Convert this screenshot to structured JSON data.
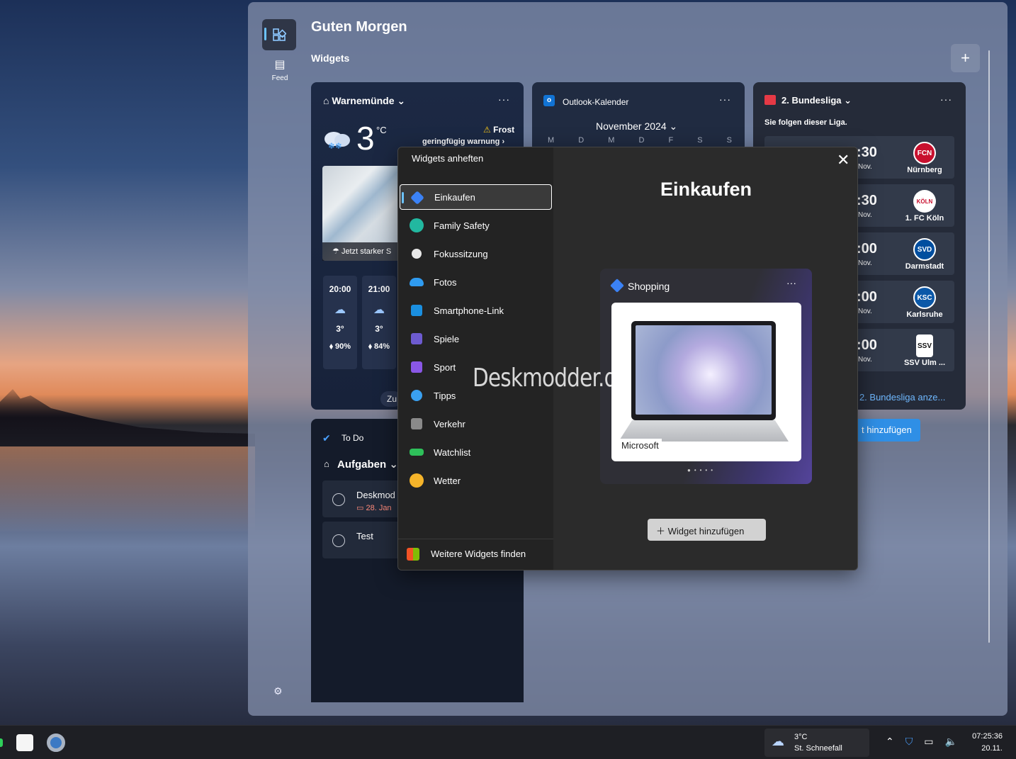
{
  "board": {
    "greeting": "Guten Morgen",
    "widgets_label": "Widgets",
    "feed_label": "Feed",
    "add_symbol": "+"
  },
  "weather": {
    "location": "Warnemünde",
    "temperature": "3",
    "unit": "°C",
    "alert_title": "Frost",
    "alert_text": "geringfügig warnung",
    "map_note": "Jetzt starker S",
    "hours": [
      {
        "time": "20:00",
        "temp": "3°",
        "precip": "90%"
      },
      {
        "time": "21:00",
        "temp": "3°",
        "precip": "84%"
      }
    ],
    "more_label": "Zu"
  },
  "calendar": {
    "title": "Outlook-Kalender",
    "month": "November 2024",
    "weekdays": [
      "M",
      "D",
      "M",
      "D",
      "F",
      "S",
      "S"
    ]
  },
  "liga": {
    "title": "2. Bundesliga",
    "subtitle": "Sie folgen dieser Liga.",
    "matches": [
      {
        "time": ":30",
        "day": "Nov.",
        "team": "Nürnberg",
        "logo": "FCN",
        "color": "#c8102e"
      },
      {
        "time": ":30",
        "day": "Nov.",
        "team": "1. FC Köln",
        "logo": "KÖLN",
        "color": "#ffffff"
      },
      {
        "time": ":00",
        "day": "Nov.",
        "team": "Darmstadt",
        "logo": "SVD",
        "color": "#004e9f"
      },
      {
        "time": ":00",
        "day": "Nov.",
        "team": "Karlsruhe",
        "logo": "KSC",
        "color": "#0b58a8"
      },
      {
        "time": ":00",
        "day": "Nov.",
        "team": "SSV Ulm ...",
        "logo": "SSV",
        "color": "#ffffff"
      }
    ],
    "link": "r 2. Bundesliga anze...",
    "add": "t hinzufügen"
  },
  "todo": {
    "title": "To Do",
    "list": "Aufgaben",
    "tasks": [
      {
        "title": "Deskmod",
        "date": "28. Jan"
      },
      {
        "title": "Test",
        "date": ""
      }
    ]
  },
  "dialog": {
    "header": "Widgets anheften",
    "items": [
      {
        "label": "Einkaufen",
        "color": "#3b82f6"
      },
      {
        "label": "Family Safety",
        "color": "#22b8a0"
      },
      {
        "label": "Fokussitzung",
        "color": "#e8e8e8"
      },
      {
        "label": "Fotos",
        "color": "#2f9bf0"
      },
      {
        "label": "Smartphone-Link",
        "color": "#1a8fe0"
      },
      {
        "label": "Spiele",
        "color": "#6d5bd0"
      },
      {
        "label": "Sport",
        "color": "#8a57e6"
      },
      {
        "label": "Tipps",
        "color": "#3aa0f0"
      },
      {
        "label": "Verkehr",
        "color": "#8a8a8a"
      },
      {
        "label": "Watchlist",
        "color": "#2ec05a"
      },
      {
        "label": "Wetter",
        "color": "#f5b42a"
      }
    ],
    "find_more": "Weitere Widgets finden",
    "selected_title": "Einkaufen",
    "preview_title": "Shopping",
    "preview_brand": "Microsoft",
    "add_button": "Widget hinzufügen"
  },
  "watermark": "Deskmodder.de",
  "taskbar": {
    "weather_temp": "3°C",
    "weather_text": "St. Schneefall",
    "time": "07:25:36",
    "date": "20.11."
  }
}
